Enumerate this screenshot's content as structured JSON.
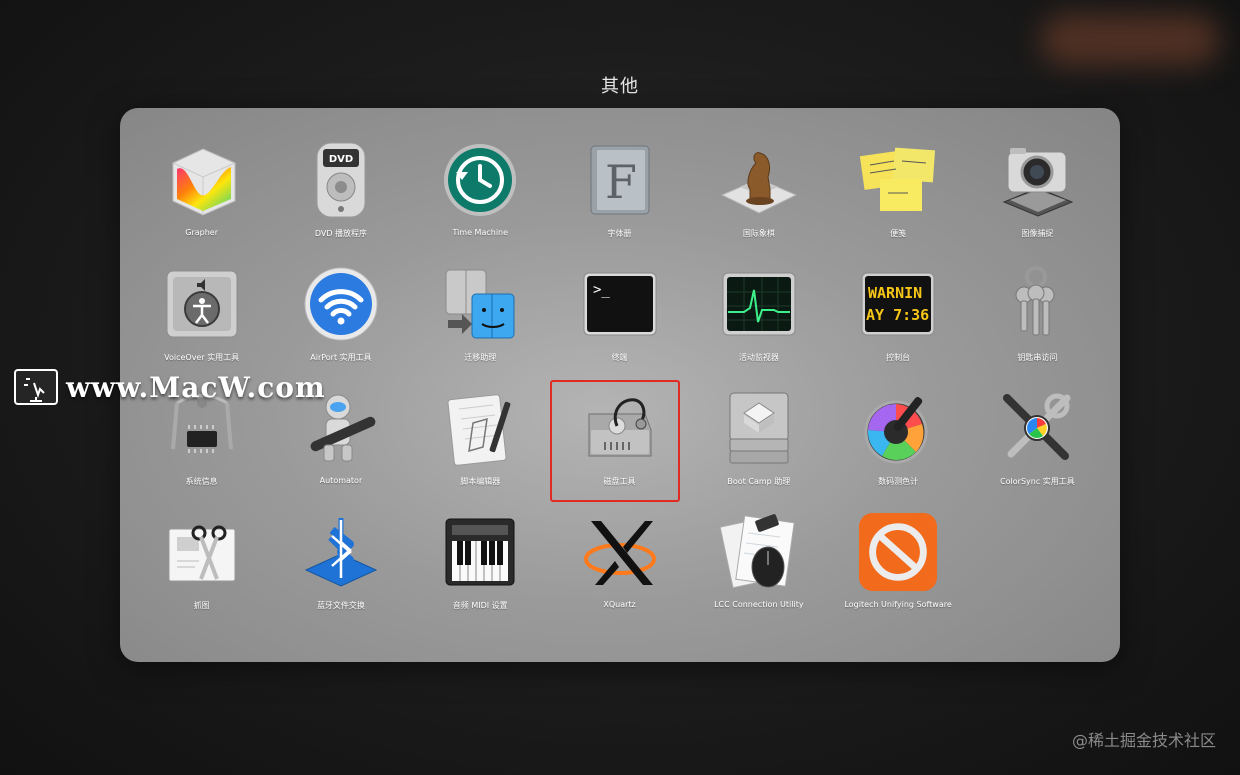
{
  "folder": {
    "title": "其他"
  },
  "apps": [
    {
      "label": "Grapher",
      "icon": "grapher-icon"
    },
    {
      "label": "DVD 播放程序",
      "icon": "dvd-player-icon"
    },
    {
      "label": "Time Machine",
      "icon": "time-machine-icon"
    },
    {
      "label": "字体册",
      "icon": "font-book-icon"
    },
    {
      "label": "国际象棋",
      "icon": "chess-icon"
    },
    {
      "label": "便笺",
      "icon": "stickies-icon"
    },
    {
      "label": "图像捕捉",
      "icon": "image-capture-icon"
    },
    {
      "label": "VoiceOver 实用工具",
      "icon": "voiceover-icon"
    },
    {
      "label": "AirPort 实用工具",
      "icon": "airport-icon"
    },
    {
      "label": "迁移助理",
      "icon": "migration-assistant-icon"
    },
    {
      "label": "终端",
      "icon": "terminal-icon",
      "text": ">_"
    },
    {
      "label": "活动监视器",
      "icon": "activity-monitor-icon"
    },
    {
      "label": "控制台",
      "icon": "console-icon",
      "text1": "WARNIN",
      "text2": "AY 7:36"
    },
    {
      "label": "钥匙串访问",
      "icon": "keychain-icon"
    },
    {
      "label": "系统信息",
      "icon": "system-information-icon"
    },
    {
      "label": "Automator",
      "icon": "automator-icon"
    },
    {
      "label": "脚本编辑器",
      "icon": "script-editor-icon"
    },
    {
      "label": "磁盘工具",
      "icon": "disk-utility-icon"
    },
    {
      "label": "Boot Camp 助理",
      "icon": "boot-camp-icon"
    },
    {
      "label": "数码测色计",
      "icon": "digital-color-meter-icon"
    },
    {
      "label": "ColorSync 实用工具",
      "icon": "colorsync-icon"
    },
    {
      "label": "抓图",
      "icon": "grab-icon"
    },
    {
      "label": "蓝牙文件交换",
      "icon": "bluetooth-icon"
    },
    {
      "label": "音频 MIDI 设置",
      "icon": "audio-midi-icon"
    },
    {
      "label": "XQuartz",
      "icon": "xquartz-icon"
    },
    {
      "label": "LCC Connection Utility",
      "icon": "lcc-connection-icon"
    },
    {
      "label": "Logitech Unifying Software",
      "icon": "logitech-unifying-icon"
    }
  ],
  "highlighted_app": "磁盘工具",
  "watermark": {
    "text": "www.MacW.com"
  },
  "credit": {
    "text": "@稀土掘金技术社区"
  },
  "colors": {
    "highlight": "#e02a22",
    "panel": "#9a9a9a",
    "background": "#1b1b1b"
  }
}
